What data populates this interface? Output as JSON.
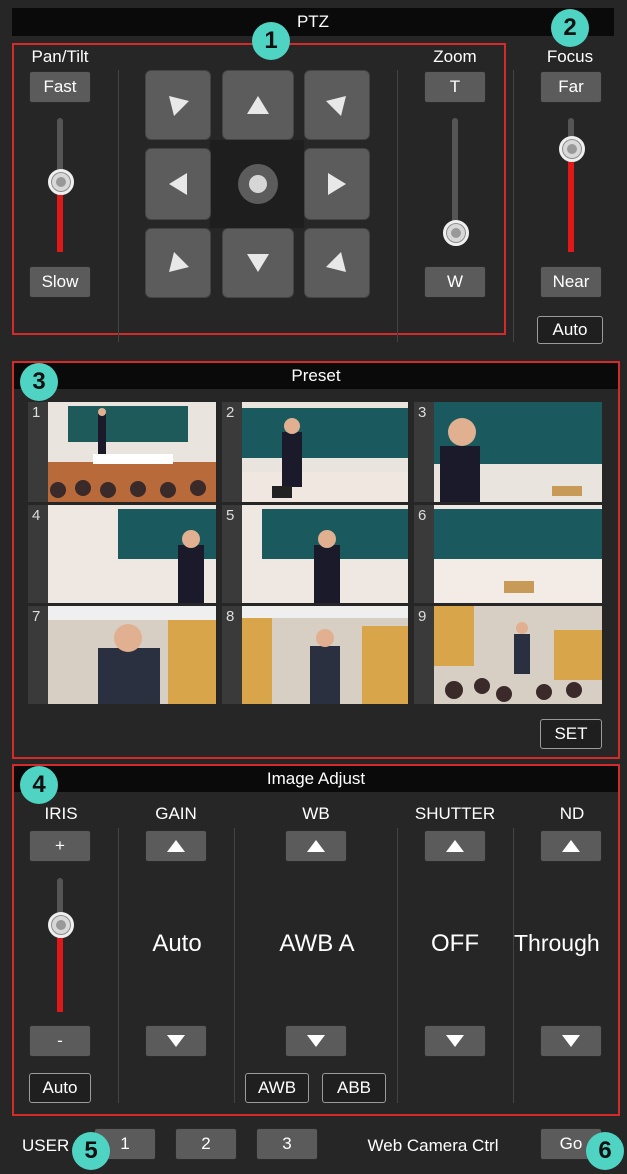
{
  "ptz": {
    "title": "PTZ",
    "pan_tilt_label": "Pan/Tilt",
    "fast": "Fast",
    "slow": "Slow",
    "pan_tilt_speed": 0.45,
    "zoom_label": "Zoom",
    "zoom_tele": "T",
    "zoom_wide": "W",
    "zoom_level": 0.0,
    "focus_label": "Focus",
    "focus_far": "Far",
    "focus_near": "Near",
    "focus_auto": "Auto",
    "focus_level": 0.75
  },
  "preset": {
    "title": "Preset",
    "items": [
      {
        "num": "1",
        "scene": "lecture-wide"
      },
      {
        "num": "2",
        "scene": "lecturer-board"
      },
      {
        "num": "3",
        "scene": "lecturer-closeup"
      },
      {
        "num": "4",
        "scene": "lecturer-board-left"
      },
      {
        "num": "5",
        "scene": "lecturer-board-center"
      },
      {
        "num": "6",
        "scene": "lecturer-board-right"
      },
      {
        "num": "7",
        "scene": "speaker-medium"
      },
      {
        "num": "8",
        "scene": "speaker-wide"
      },
      {
        "num": "9",
        "scene": "audience-wide"
      }
    ],
    "set": "SET"
  },
  "image_adjust": {
    "title": "Image Adjust",
    "iris_label": "IRIS",
    "iris_plus": "+",
    "iris_minus": "-",
    "iris_auto": "Auto",
    "iris_level": 0.75,
    "gain_label": "GAIN",
    "gain_value": "Auto",
    "wb_label": "WB",
    "wb_value": "AWB A",
    "awb": "AWB",
    "abb": "ABB",
    "shutter_label": "SHUTTER",
    "shutter_value": "OFF",
    "nd_label": "ND",
    "nd_value": "Through"
  },
  "footer": {
    "user_label": "USER",
    "user1": "1",
    "user2": "2",
    "user3": "3",
    "web_camera_ctrl": "Web Camera Ctrl",
    "go": "Go"
  },
  "callouts": [
    "1",
    "2",
    "3",
    "4",
    "5",
    "6"
  ],
  "colors": {
    "accent_red": "#d42a2a",
    "slider_fill": "#e01818",
    "callout": "#4fd3c2"
  }
}
